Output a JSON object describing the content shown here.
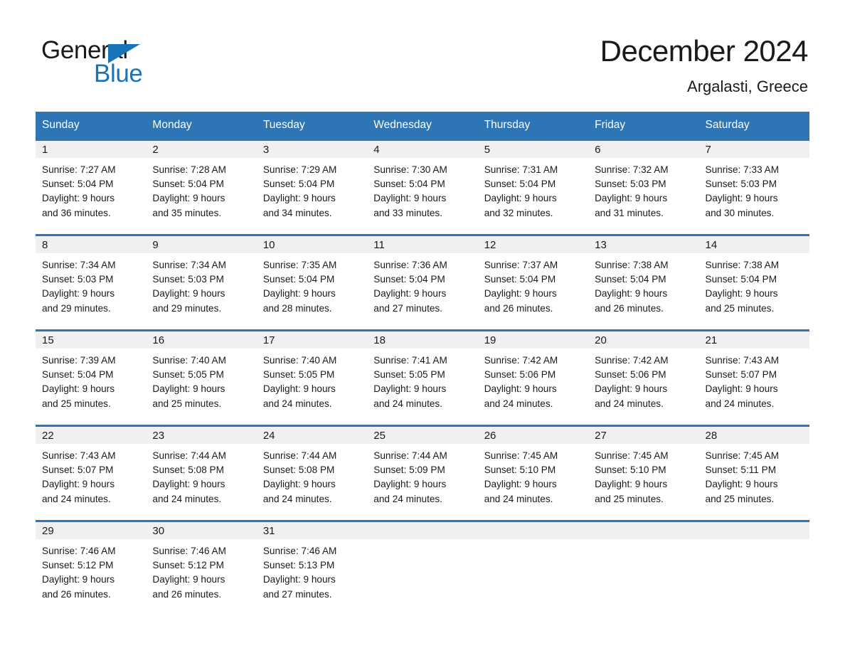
{
  "brand": {
    "name_part1": "General",
    "name_part2": "Blue",
    "logo_icon": "triangle-logo-icon"
  },
  "header": {
    "month_title": "December 2024",
    "location": "Argalasti, Greece"
  },
  "colors": {
    "header_blue": "#2e75b6",
    "brand_blue": "#1874b8",
    "daynum_band": "#f0f0f0",
    "text": "#1a1a1a"
  },
  "calendar": {
    "weekday_headers": [
      "Sunday",
      "Monday",
      "Tuesday",
      "Wednesday",
      "Thursday",
      "Friday",
      "Saturday"
    ],
    "weeks": [
      [
        {
          "day": "1",
          "sunrise": "Sunrise: 7:27 AM",
          "sunset": "Sunset: 5:04 PM",
          "daylight_line1": "Daylight: 9 hours",
          "daylight_line2": "and 36 minutes."
        },
        {
          "day": "2",
          "sunrise": "Sunrise: 7:28 AM",
          "sunset": "Sunset: 5:04 PM",
          "daylight_line1": "Daylight: 9 hours",
          "daylight_line2": "and 35 minutes."
        },
        {
          "day": "3",
          "sunrise": "Sunrise: 7:29 AM",
          "sunset": "Sunset: 5:04 PM",
          "daylight_line1": "Daylight: 9 hours",
          "daylight_line2": "and 34 minutes."
        },
        {
          "day": "4",
          "sunrise": "Sunrise: 7:30 AM",
          "sunset": "Sunset: 5:04 PM",
          "daylight_line1": "Daylight: 9 hours",
          "daylight_line2": "and 33 minutes."
        },
        {
          "day": "5",
          "sunrise": "Sunrise: 7:31 AM",
          "sunset": "Sunset: 5:04 PM",
          "daylight_line1": "Daylight: 9 hours",
          "daylight_line2": "and 32 minutes."
        },
        {
          "day": "6",
          "sunrise": "Sunrise: 7:32 AM",
          "sunset": "Sunset: 5:03 PM",
          "daylight_line1": "Daylight: 9 hours",
          "daylight_line2": "and 31 minutes."
        },
        {
          "day": "7",
          "sunrise": "Sunrise: 7:33 AM",
          "sunset": "Sunset: 5:03 PM",
          "daylight_line1": "Daylight: 9 hours",
          "daylight_line2": "and 30 minutes."
        }
      ],
      [
        {
          "day": "8",
          "sunrise": "Sunrise: 7:34 AM",
          "sunset": "Sunset: 5:03 PM",
          "daylight_line1": "Daylight: 9 hours",
          "daylight_line2": "and 29 minutes."
        },
        {
          "day": "9",
          "sunrise": "Sunrise: 7:34 AM",
          "sunset": "Sunset: 5:03 PM",
          "daylight_line1": "Daylight: 9 hours",
          "daylight_line2": "and 29 minutes."
        },
        {
          "day": "10",
          "sunrise": "Sunrise: 7:35 AM",
          "sunset": "Sunset: 5:04 PM",
          "daylight_line1": "Daylight: 9 hours",
          "daylight_line2": "and 28 minutes."
        },
        {
          "day": "11",
          "sunrise": "Sunrise: 7:36 AM",
          "sunset": "Sunset: 5:04 PM",
          "daylight_line1": "Daylight: 9 hours",
          "daylight_line2": "and 27 minutes."
        },
        {
          "day": "12",
          "sunrise": "Sunrise: 7:37 AM",
          "sunset": "Sunset: 5:04 PM",
          "daylight_line1": "Daylight: 9 hours",
          "daylight_line2": "and 26 minutes."
        },
        {
          "day": "13",
          "sunrise": "Sunrise: 7:38 AM",
          "sunset": "Sunset: 5:04 PM",
          "daylight_line1": "Daylight: 9 hours",
          "daylight_line2": "and 26 minutes."
        },
        {
          "day": "14",
          "sunrise": "Sunrise: 7:38 AM",
          "sunset": "Sunset: 5:04 PM",
          "daylight_line1": "Daylight: 9 hours",
          "daylight_line2": "and 25 minutes."
        }
      ],
      [
        {
          "day": "15",
          "sunrise": "Sunrise: 7:39 AM",
          "sunset": "Sunset: 5:04 PM",
          "daylight_line1": "Daylight: 9 hours",
          "daylight_line2": "and 25 minutes."
        },
        {
          "day": "16",
          "sunrise": "Sunrise: 7:40 AM",
          "sunset": "Sunset: 5:05 PM",
          "daylight_line1": "Daylight: 9 hours",
          "daylight_line2": "and 25 minutes."
        },
        {
          "day": "17",
          "sunrise": "Sunrise: 7:40 AM",
          "sunset": "Sunset: 5:05 PM",
          "daylight_line1": "Daylight: 9 hours",
          "daylight_line2": "and 24 minutes."
        },
        {
          "day": "18",
          "sunrise": "Sunrise: 7:41 AM",
          "sunset": "Sunset: 5:05 PM",
          "daylight_line1": "Daylight: 9 hours",
          "daylight_line2": "and 24 minutes."
        },
        {
          "day": "19",
          "sunrise": "Sunrise: 7:42 AM",
          "sunset": "Sunset: 5:06 PM",
          "daylight_line1": "Daylight: 9 hours",
          "daylight_line2": "and 24 minutes."
        },
        {
          "day": "20",
          "sunrise": "Sunrise: 7:42 AM",
          "sunset": "Sunset: 5:06 PM",
          "daylight_line1": "Daylight: 9 hours",
          "daylight_line2": "and 24 minutes."
        },
        {
          "day": "21",
          "sunrise": "Sunrise: 7:43 AM",
          "sunset": "Sunset: 5:07 PM",
          "daylight_line1": "Daylight: 9 hours",
          "daylight_line2": "and 24 minutes."
        }
      ],
      [
        {
          "day": "22",
          "sunrise": "Sunrise: 7:43 AM",
          "sunset": "Sunset: 5:07 PM",
          "daylight_line1": "Daylight: 9 hours",
          "daylight_line2": "and 24 minutes."
        },
        {
          "day": "23",
          "sunrise": "Sunrise: 7:44 AM",
          "sunset": "Sunset: 5:08 PM",
          "daylight_line1": "Daylight: 9 hours",
          "daylight_line2": "and 24 minutes."
        },
        {
          "day": "24",
          "sunrise": "Sunrise: 7:44 AM",
          "sunset": "Sunset: 5:08 PM",
          "daylight_line1": "Daylight: 9 hours",
          "daylight_line2": "and 24 minutes."
        },
        {
          "day": "25",
          "sunrise": "Sunrise: 7:44 AM",
          "sunset": "Sunset: 5:09 PM",
          "daylight_line1": "Daylight: 9 hours",
          "daylight_line2": "and 24 minutes."
        },
        {
          "day": "26",
          "sunrise": "Sunrise: 7:45 AM",
          "sunset": "Sunset: 5:10 PM",
          "daylight_line1": "Daylight: 9 hours",
          "daylight_line2": "and 24 minutes."
        },
        {
          "day": "27",
          "sunrise": "Sunrise: 7:45 AM",
          "sunset": "Sunset: 5:10 PM",
          "daylight_line1": "Daylight: 9 hours",
          "daylight_line2": "and 25 minutes."
        },
        {
          "day": "28",
          "sunrise": "Sunrise: 7:45 AM",
          "sunset": "Sunset: 5:11 PM",
          "daylight_line1": "Daylight: 9 hours",
          "daylight_line2": "and 25 minutes."
        }
      ],
      [
        {
          "day": "29",
          "sunrise": "Sunrise: 7:46 AM",
          "sunset": "Sunset: 5:12 PM",
          "daylight_line1": "Daylight: 9 hours",
          "daylight_line2": "and 26 minutes."
        },
        {
          "day": "30",
          "sunrise": "Sunrise: 7:46 AM",
          "sunset": "Sunset: 5:12 PM",
          "daylight_line1": "Daylight: 9 hours",
          "daylight_line2": "and 26 minutes."
        },
        {
          "day": "31",
          "sunrise": "Sunrise: 7:46 AM",
          "sunset": "Sunset: 5:13 PM",
          "daylight_line1": "Daylight: 9 hours",
          "daylight_line2": "and 27 minutes."
        },
        {
          "day": "",
          "sunrise": "",
          "sunset": "",
          "daylight_line1": "",
          "daylight_line2": ""
        },
        {
          "day": "",
          "sunrise": "",
          "sunset": "",
          "daylight_line1": "",
          "daylight_line2": ""
        },
        {
          "day": "",
          "sunrise": "",
          "sunset": "",
          "daylight_line1": "",
          "daylight_line2": ""
        },
        {
          "day": "",
          "sunrise": "",
          "sunset": "",
          "daylight_line1": "",
          "daylight_line2": ""
        }
      ]
    ]
  }
}
